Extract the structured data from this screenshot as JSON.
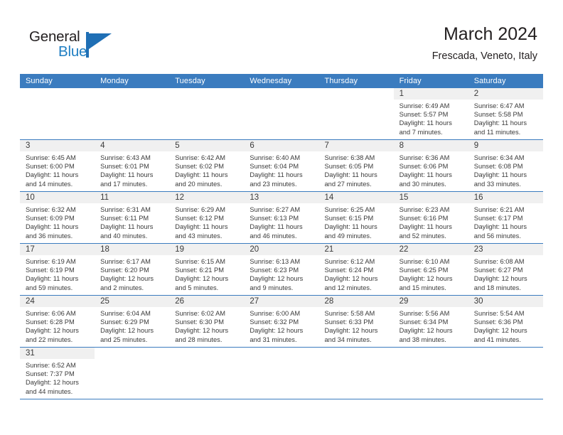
{
  "brand": {
    "name_part1": "General",
    "name_part2": "Blue",
    "logo_icon": "triangle-flag-icon",
    "accent_color": "#1f6fb5"
  },
  "header": {
    "title": "March 2024",
    "subtitle": "Frescada, Veneto, Italy"
  },
  "calendar": {
    "header_bg": "#3b7cbf",
    "daynum_band_bg": "#f0f0f0",
    "weekdays": [
      "Sunday",
      "Monday",
      "Tuesday",
      "Wednesday",
      "Thursday",
      "Friday",
      "Saturday"
    ],
    "weeks": [
      [
        {
          "day": "",
          "sunrise": "",
          "sunset": "",
          "daylight_line1": "",
          "daylight_line2": ""
        },
        {
          "day": "",
          "sunrise": "",
          "sunset": "",
          "daylight_line1": "",
          "daylight_line2": ""
        },
        {
          "day": "",
          "sunrise": "",
          "sunset": "",
          "daylight_line1": "",
          "daylight_line2": ""
        },
        {
          "day": "",
          "sunrise": "",
          "sunset": "",
          "daylight_line1": "",
          "daylight_line2": ""
        },
        {
          "day": "",
          "sunrise": "",
          "sunset": "",
          "daylight_line1": "",
          "daylight_line2": ""
        },
        {
          "day": "1",
          "sunrise": "Sunrise: 6:49 AM",
          "sunset": "Sunset: 5:57 PM",
          "daylight_line1": "Daylight: 11 hours",
          "daylight_line2": "and 7 minutes."
        },
        {
          "day": "2",
          "sunrise": "Sunrise: 6:47 AM",
          "sunset": "Sunset: 5:58 PM",
          "daylight_line1": "Daylight: 11 hours",
          "daylight_line2": "and 11 minutes."
        }
      ],
      [
        {
          "day": "3",
          "sunrise": "Sunrise: 6:45 AM",
          "sunset": "Sunset: 6:00 PM",
          "daylight_line1": "Daylight: 11 hours",
          "daylight_line2": "and 14 minutes."
        },
        {
          "day": "4",
          "sunrise": "Sunrise: 6:43 AM",
          "sunset": "Sunset: 6:01 PM",
          "daylight_line1": "Daylight: 11 hours",
          "daylight_line2": "and 17 minutes."
        },
        {
          "day": "5",
          "sunrise": "Sunrise: 6:42 AM",
          "sunset": "Sunset: 6:02 PM",
          "daylight_line1": "Daylight: 11 hours",
          "daylight_line2": "and 20 minutes."
        },
        {
          "day": "6",
          "sunrise": "Sunrise: 6:40 AM",
          "sunset": "Sunset: 6:04 PM",
          "daylight_line1": "Daylight: 11 hours",
          "daylight_line2": "and 23 minutes."
        },
        {
          "day": "7",
          "sunrise": "Sunrise: 6:38 AM",
          "sunset": "Sunset: 6:05 PM",
          "daylight_line1": "Daylight: 11 hours",
          "daylight_line2": "and 27 minutes."
        },
        {
          "day": "8",
          "sunrise": "Sunrise: 6:36 AM",
          "sunset": "Sunset: 6:06 PM",
          "daylight_line1": "Daylight: 11 hours",
          "daylight_line2": "and 30 minutes."
        },
        {
          "day": "9",
          "sunrise": "Sunrise: 6:34 AM",
          "sunset": "Sunset: 6:08 PM",
          "daylight_line1": "Daylight: 11 hours",
          "daylight_line2": "and 33 minutes."
        }
      ],
      [
        {
          "day": "10",
          "sunrise": "Sunrise: 6:32 AM",
          "sunset": "Sunset: 6:09 PM",
          "daylight_line1": "Daylight: 11 hours",
          "daylight_line2": "and 36 minutes."
        },
        {
          "day": "11",
          "sunrise": "Sunrise: 6:31 AM",
          "sunset": "Sunset: 6:11 PM",
          "daylight_line1": "Daylight: 11 hours",
          "daylight_line2": "and 40 minutes."
        },
        {
          "day": "12",
          "sunrise": "Sunrise: 6:29 AM",
          "sunset": "Sunset: 6:12 PM",
          "daylight_line1": "Daylight: 11 hours",
          "daylight_line2": "and 43 minutes."
        },
        {
          "day": "13",
          "sunrise": "Sunrise: 6:27 AM",
          "sunset": "Sunset: 6:13 PM",
          "daylight_line1": "Daylight: 11 hours",
          "daylight_line2": "and 46 minutes."
        },
        {
          "day": "14",
          "sunrise": "Sunrise: 6:25 AM",
          "sunset": "Sunset: 6:15 PM",
          "daylight_line1": "Daylight: 11 hours",
          "daylight_line2": "and 49 minutes."
        },
        {
          "day": "15",
          "sunrise": "Sunrise: 6:23 AM",
          "sunset": "Sunset: 6:16 PM",
          "daylight_line1": "Daylight: 11 hours",
          "daylight_line2": "and 52 minutes."
        },
        {
          "day": "16",
          "sunrise": "Sunrise: 6:21 AM",
          "sunset": "Sunset: 6:17 PM",
          "daylight_line1": "Daylight: 11 hours",
          "daylight_line2": "and 56 minutes."
        }
      ],
      [
        {
          "day": "17",
          "sunrise": "Sunrise: 6:19 AM",
          "sunset": "Sunset: 6:19 PM",
          "daylight_line1": "Daylight: 11 hours",
          "daylight_line2": "and 59 minutes."
        },
        {
          "day": "18",
          "sunrise": "Sunrise: 6:17 AM",
          "sunset": "Sunset: 6:20 PM",
          "daylight_line1": "Daylight: 12 hours",
          "daylight_line2": "and 2 minutes."
        },
        {
          "day": "19",
          "sunrise": "Sunrise: 6:15 AM",
          "sunset": "Sunset: 6:21 PM",
          "daylight_line1": "Daylight: 12 hours",
          "daylight_line2": "and 5 minutes."
        },
        {
          "day": "20",
          "sunrise": "Sunrise: 6:13 AM",
          "sunset": "Sunset: 6:23 PM",
          "daylight_line1": "Daylight: 12 hours",
          "daylight_line2": "and 9 minutes."
        },
        {
          "day": "21",
          "sunrise": "Sunrise: 6:12 AM",
          "sunset": "Sunset: 6:24 PM",
          "daylight_line1": "Daylight: 12 hours",
          "daylight_line2": "and 12 minutes."
        },
        {
          "day": "22",
          "sunrise": "Sunrise: 6:10 AM",
          "sunset": "Sunset: 6:25 PM",
          "daylight_line1": "Daylight: 12 hours",
          "daylight_line2": "and 15 minutes."
        },
        {
          "day": "23",
          "sunrise": "Sunrise: 6:08 AM",
          "sunset": "Sunset: 6:27 PM",
          "daylight_line1": "Daylight: 12 hours",
          "daylight_line2": "and 18 minutes."
        }
      ],
      [
        {
          "day": "24",
          "sunrise": "Sunrise: 6:06 AM",
          "sunset": "Sunset: 6:28 PM",
          "daylight_line1": "Daylight: 12 hours",
          "daylight_line2": "and 22 minutes."
        },
        {
          "day": "25",
          "sunrise": "Sunrise: 6:04 AM",
          "sunset": "Sunset: 6:29 PM",
          "daylight_line1": "Daylight: 12 hours",
          "daylight_line2": "and 25 minutes."
        },
        {
          "day": "26",
          "sunrise": "Sunrise: 6:02 AM",
          "sunset": "Sunset: 6:30 PM",
          "daylight_line1": "Daylight: 12 hours",
          "daylight_line2": "and 28 minutes."
        },
        {
          "day": "27",
          "sunrise": "Sunrise: 6:00 AM",
          "sunset": "Sunset: 6:32 PM",
          "daylight_line1": "Daylight: 12 hours",
          "daylight_line2": "and 31 minutes."
        },
        {
          "day": "28",
          "sunrise": "Sunrise: 5:58 AM",
          "sunset": "Sunset: 6:33 PM",
          "daylight_line1": "Daylight: 12 hours",
          "daylight_line2": "and 34 minutes."
        },
        {
          "day": "29",
          "sunrise": "Sunrise: 5:56 AM",
          "sunset": "Sunset: 6:34 PM",
          "daylight_line1": "Daylight: 12 hours",
          "daylight_line2": "and 38 minutes."
        },
        {
          "day": "30",
          "sunrise": "Sunrise: 5:54 AM",
          "sunset": "Sunset: 6:36 PM",
          "daylight_line1": "Daylight: 12 hours",
          "daylight_line2": "and 41 minutes."
        }
      ],
      [
        {
          "day": "31",
          "sunrise": "Sunrise: 6:52 AM",
          "sunset": "Sunset: 7:37 PM",
          "daylight_line1": "Daylight: 12 hours",
          "daylight_line2": "and 44 minutes."
        },
        {
          "day": "",
          "sunrise": "",
          "sunset": "",
          "daylight_line1": "",
          "daylight_line2": ""
        },
        {
          "day": "",
          "sunrise": "",
          "sunset": "",
          "daylight_line1": "",
          "daylight_line2": ""
        },
        {
          "day": "",
          "sunrise": "",
          "sunset": "",
          "daylight_line1": "",
          "daylight_line2": ""
        },
        {
          "day": "",
          "sunrise": "",
          "sunset": "",
          "daylight_line1": "",
          "daylight_line2": ""
        },
        {
          "day": "",
          "sunrise": "",
          "sunset": "",
          "daylight_line1": "",
          "daylight_line2": ""
        },
        {
          "day": "",
          "sunrise": "",
          "sunset": "",
          "daylight_line1": "",
          "daylight_line2": ""
        }
      ]
    ]
  }
}
